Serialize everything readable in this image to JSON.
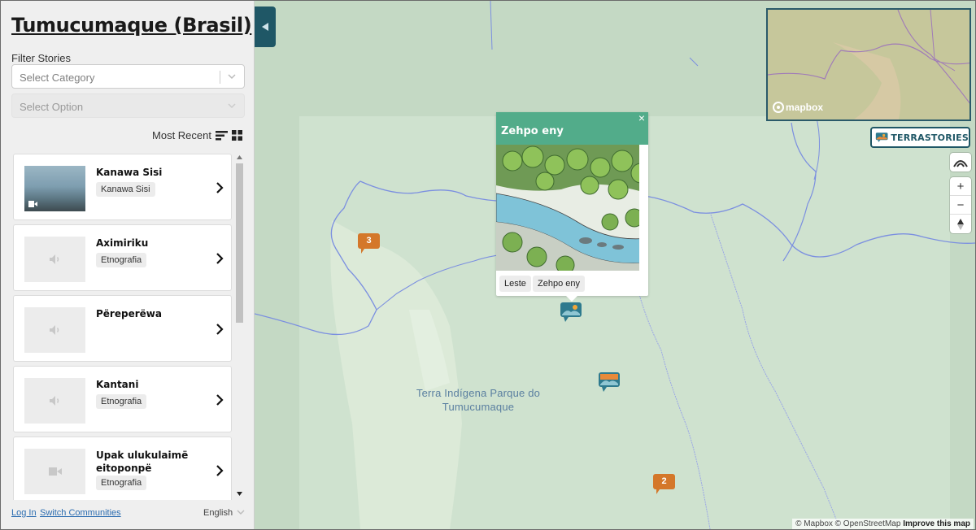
{
  "sidebar": {
    "title": "Tumucumaque (Brasil)",
    "filter_label": "Filter Stories",
    "category_placeholder": "Select Category",
    "option_placeholder": "Select Option",
    "sort_label": "Most Recent",
    "stories": [
      {
        "title": "Kanawa Sisi",
        "tag": "Kanawa Sisi",
        "media": "video"
      },
      {
        "title": "Aximiriku",
        "tag": "Etnografia",
        "media": "audio"
      },
      {
        "title": "Përeperëwa",
        "tag": "",
        "media": "audio"
      },
      {
        "title": "Kantani",
        "tag": "Etnografia",
        "media": "audio"
      },
      {
        "title": "Upak ulukulaimë eitoponpë",
        "tag": "Etnografia",
        "media": "video"
      }
    ],
    "footer": {
      "login": "Log In",
      "switch": "Switch Communities",
      "language": "English"
    }
  },
  "map": {
    "area_label": "Terra Indígena Parque do Tumucumaque",
    "minimap_logo": "mapbox",
    "brand": "TERRASTORIES",
    "popup": {
      "title": "Zehpo eny",
      "tags": [
        "Leste",
        "Zehpo eny"
      ]
    },
    "clusters": [
      "3",
      "2"
    ],
    "zoom_in": "+",
    "zoom_out": "−",
    "attribution_1": "© Mapbox © OpenStreetMap",
    "attribution_2": "Improve this map"
  },
  "colors": {
    "accent": "#1f5766",
    "popup_header": "#52ac8a",
    "cluster": "#d4772a"
  }
}
